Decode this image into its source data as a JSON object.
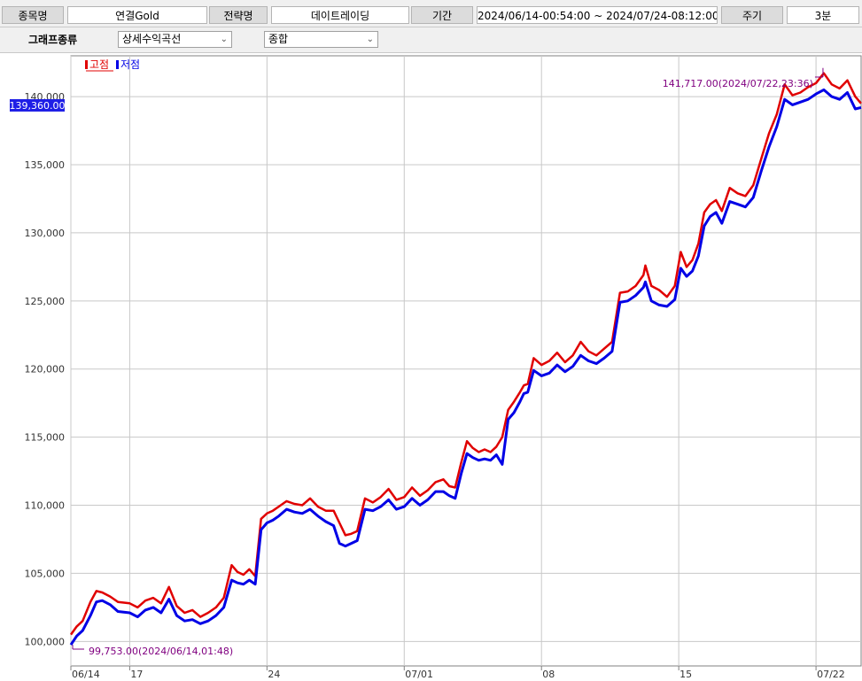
{
  "header": {
    "symbol_label": "종목명",
    "symbol_value": "연결Gold",
    "strategy_label": "전략명",
    "strategy_value": "데이트레이딩",
    "period_label": "기간",
    "period_value": "2024/06/14-00:54:00 ~ 2024/07/24-08:12:00",
    "cycle_label": "주기",
    "cycle_value": "3분"
  },
  "options": {
    "graph_type_label": "그래프종류",
    "graph_type_value": "상세수익곡선",
    "view_value": "종합",
    "dropdown_icon": "chevron-down-icon"
  },
  "chart_data": {
    "type": "line",
    "legend": [
      {
        "name": "고점",
        "color": "#e00000"
      },
      {
        "name": "저점",
        "color": "#0000e6"
      }
    ],
    "ylim": [
      98200,
      143000
    ],
    "yticks": [
      100000,
      105000,
      110000,
      115000,
      120000,
      125000,
      130000,
      135000,
      140000
    ],
    "ytick_labels": [
      "100,000",
      "105,000",
      "110,000",
      "115,000",
      "120,000",
      "125,000",
      "130,000",
      "135,000",
      "140,000"
    ],
    "xticks": [
      {
        "day": 0,
        "label": "06/14"
      },
      {
        "day": 3,
        "label": "17"
      },
      {
        "day": 10,
        "label": "24"
      },
      {
        "day": 17,
        "label": "07/01"
      },
      {
        "day": 24,
        "label": "08"
      },
      {
        "day": 31,
        "label": "15"
      },
      {
        "day": 38,
        "label": "07/22"
      }
    ],
    "xlim": [
      0,
      40.3
    ],
    "grid": true,
    "current_value": 139360,
    "current_label": "139,360.00",
    "max_annotation": "141,717.00(2024/07/22,23:36)",
    "min_annotation": "99,753.00(2024/06/14,01:48)",
    "min_value": 99753,
    "max_value": 141717,
    "x": [
      0,
      0.3,
      0.6,
      1,
      1.3,
      1.6,
      2,
      2.4,
      3,
      3.4,
      3.8,
      4.2,
      4.6,
      5,
      5.4,
      5.8,
      6.2,
      6.6,
      7,
      7.4,
      7.8,
      8.2,
      8.5,
      8.8,
      9.1,
      9.4,
      9.7,
      10,
      10.3,
      10.6,
      11,
      11.4,
      11.8,
      12.2,
      12.6,
      13,
      13.4,
      13.7,
      14,
      14.3,
      14.6,
      15,
      15.4,
      15.8,
      16.2,
      16.6,
      17,
      17.4,
      17.8,
      18.2,
      18.6,
      19,
      19.3,
      19.6,
      19.9,
      20.2,
      20.5,
      20.8,
      21.1,
      21.4,
      21.7,
      22,
      22.3,
      22.6,
      22.9,
      23.1,
      23.3,
      23.6,
      24,
      24.4,
      24.8,
      25.2,
      25.6,
      26,
      26.4,
      26.8,
      27.2,
      27.6,
      28,
      28.4,
      28.8,
      29.2,
      29.3,
      29.6,
      30,
      30.4,
      30.8,
      31.1,
      31.4,
      31.7,
      32,
      32.3,
      32.6,
      32.9,
      33.2,
      33.6,
      34,
      34.4,
      34.8,
      35.2,
      35.6,
      36,
      36.4,
      36.8,
      37.2,
      37.6,
      38,
      38.4,
      38.8,
      39.2,
      39.6,
      40,
      40.3
    ],
    "y_high": [
      100500,
      101100,
      101500,
      102900,
      103700,
      103600,
      103300,
      102900,
      102800,
      102500,
      103000,
      103200,
      102800,
      104000,
      102600,
      102100,
      102300,
      101800,
      102100,
      102500,
      103200,
      105600,
      105100,
      104900,
      105300,
      104800,
      109000,
      109400,
      109600,
      109900,
      110300,
      110100,
      110000,
      110500,
      109900,
      109600,
      109600,
      108700,
      107800,
      107900,
      108100,
      110500,
      110200,
      110600,
      111200,
      110400,
      110600,
      111300,
      110700,
      111100,
      111700,
      111900,
      111400,
      111300,
      113100,
      114700,
      114200,
      113900,
      114100,
      113900,
      114300,
      115000,
      117000,
      117600,
      118300,
      118800,
      118900,
      120800,
      120300,
      120600,
      121200,
      120500,
      121000,
      122000,
      121300,
      121000,
      121500,
      122000,
      125600,
      125700,
      126100,
      126900,
      127600,
      126100,
      125800,
      125300,
      126100,
      128600,
      127500,
      128000,
      129200,
      131500,
      132100,
      132400,
      131600,
      133300,
      132900,
      132700,
      133500,
      135400,
      137300,
      138700,
      140900,
      140100,
      140300,
      140700,
      141000,
      141717,
      140900,
      140600,
      141200,
      140000,
      139500
    ],
    "y_low": [
      99753,
      100400,
      100800,
      101900,
      102900,
      103000,
      102700,
      102200,
      102100,
      101800,
      102300,
      102500,
      102100,
      103100,
      101900,
      101500,
      101600,
      101300,
      101500,
      101900,
      102500,
      104500,
      104300,
      104200,
      104500,
      104200,
      108200,
      108700,
      108900,
      109200,
      109700,
      109500,
      109400,
      109700,
      109200,
      108800,
      108500,
      107200,
      107000,
      107200,
      107400,
      109700,
      109600,
      109900,
      110400,
      109700,
      109900,
      110500,
      110000,
      110400,
      111000,
      111000,
      110700,
      110500,
      112300,
      113800,
      113500,
      113300,
      113400,
      113300,
      113700,
      113000,
      116300,
      116800,
      117600,
      118200,
      118300,
      119900,
      119500,
      119700,
      120300,
      119800,
      120200,
      121000,
      120600,
      120400,
      120800,
      121300,
      124900,
      125000,
      125400,
      126000,
      126400,
      125000,
      124700,
      124600,
      125100,
      127400,
      126800,
      127200,
      128300,
      130500,
      131200,
      131500,
      130700,
      132300,
      132100,
      131900,
      132600,
      134500,
      136300,
      137800,
      139800,
      139400,
      139600,
      139800,
      140200,
      140500,
      140000,
      139800,
      140300,
      139100,
      139200
    ]
  }
}
